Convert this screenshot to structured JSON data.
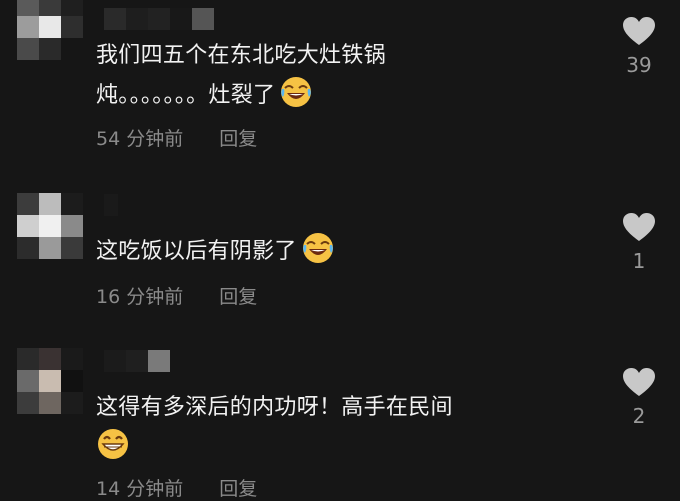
{
  "comments": [
    {
      "line1": "我们四五个在东北吃大灶铁锅",
      "line2": "炖。。。。。。。灶裂了",
      "emoji": "rofl-emoji",
      "time": "54 分钟前",
      "reply": "回复",
      "likes": "39"
    },
    {
      "line1": "这吃饭以后有阴影了",
      "emoji": "rofl-emoji",
      "time": "16 分钟前",
      "reply": "回复",
      "likes": "1"
    },
    {
      "line1": "这得有多深后的内功呀！高手在民间",
      "emoji": "grin-emoji",
      "time": "14 分钟前",
      "reply": "回复",
      "likes": "2"
    }
  ],
  "icons": {
    "like": "heart-icon"
  },
  "colors": {
    "background": "#161616",
    "text": "#f2f2f2",
    "meta": "#8a8a8a",
    "heart": "#c8c8c8"
  }
}
